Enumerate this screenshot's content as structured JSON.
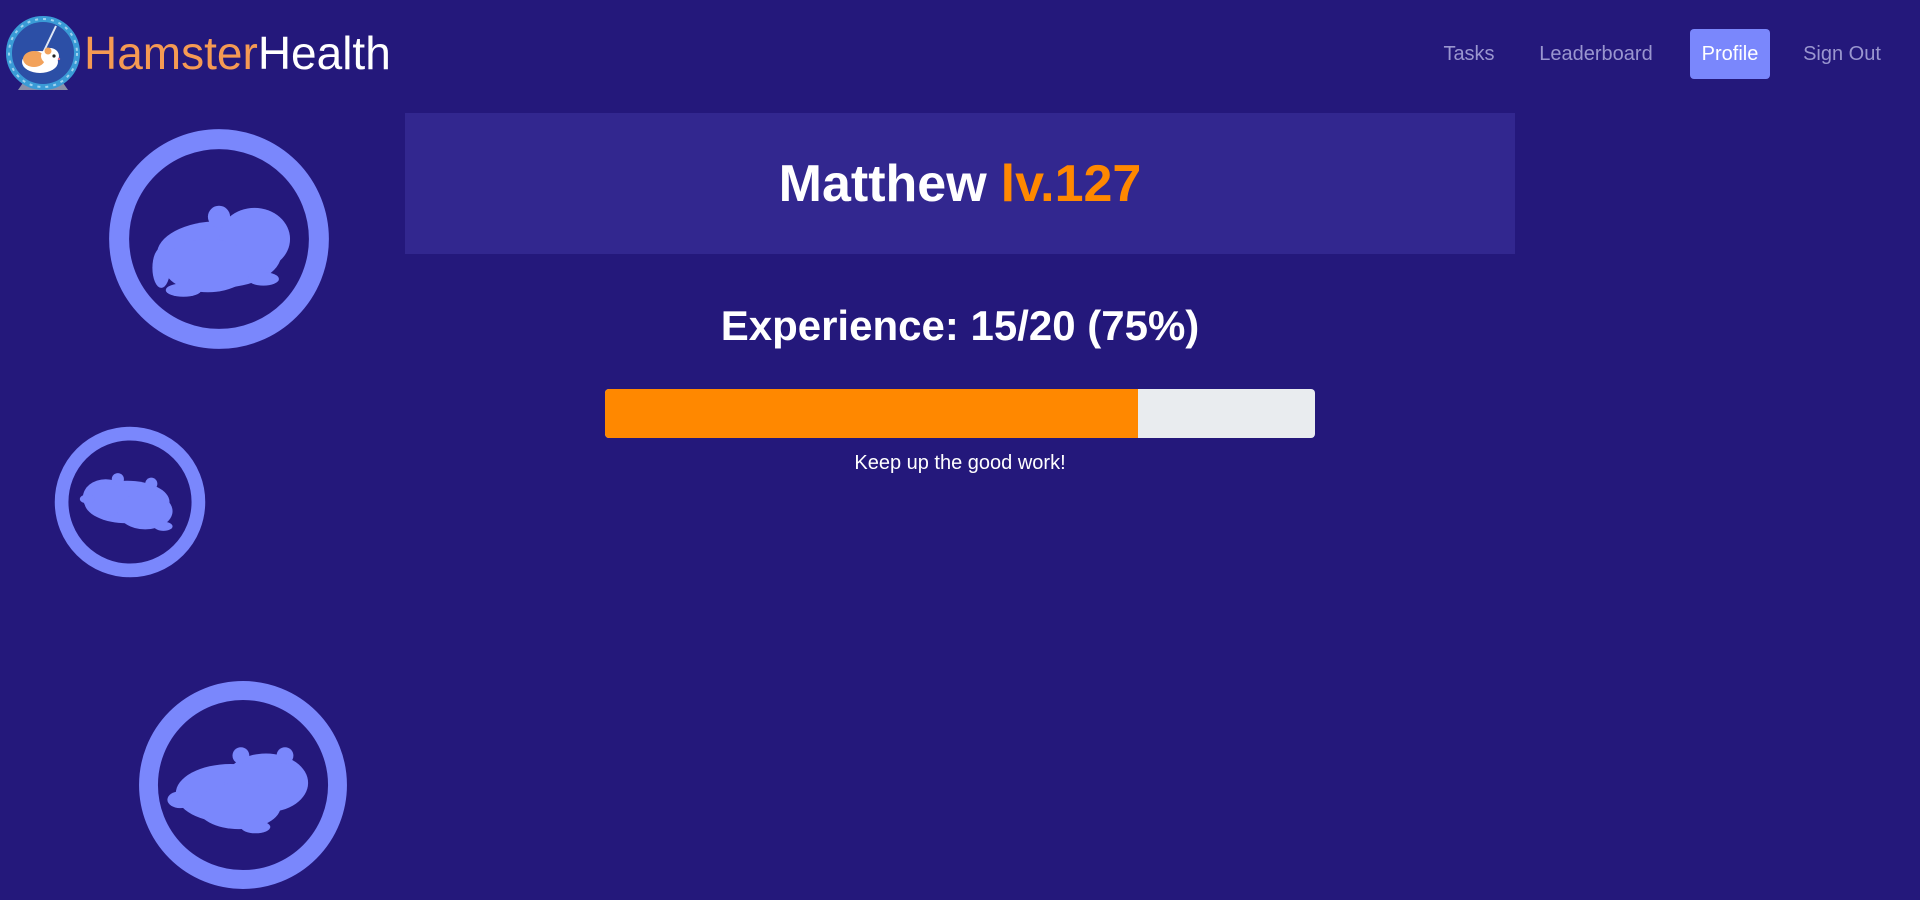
{
  "brand": {
    "name_part1": "Hamster",
    "name_part2": "Health",
    "logo_icon": "hamster-wheel-icon"
  },
  "nav": {
    "items": [
      {
        "label": "Tasks",
        "active": false
      },
      {
        "label": "Leaderboard",
        "active": false
      },
      {
        "label": "Profile",
        "active": true
      },
      {
        "label": "Sign Out",
        "active": false
      }
    ]
  },
  "profile": {
    "name": "Matthew",
    "level": "lv.127"
  },
  "experience": {
    "heading": "Experience: 15/20 (75%)",
    "progress_fraction": 0.75,
    "message": "Keep up the good work!"
  },
  "decorations": {
    "icon": "hamster-wheel-icon",
    "color": "#7a87fc"
  },
  "colors": {
    "background": "#24187b",
    "banner": "#32278f",
    "accent_orange": "#ff8800",
    "brand_orange": "#f59a53",
    "nav_active": "#7a87fc",
    "nav_text": "#9a96cf",
    "progress_track": "#e9ecef"
  }
}
